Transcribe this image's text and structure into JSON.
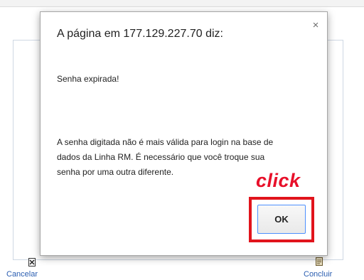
{
  "dialog": {
    "title": "A página em 177.129.227.70 diz:",
    "close_glyph": "×",
    "message_lines": [
      "Senha expirada!",
      "A senha digitada não é mais válida para login na base de",
      "dados da Linha RM. É necessário que você troque sua",
      "senha por uma outra diferente."
    ],
    "ok_label": "OK"
  },
  "annotation": {
    "label": "click",
    "color": "#e1141c"
  },
  "background": {
    "cancel_label": "Cancelar",
    "finish_label": "Concluir",
    "cancel_icon": "document-x-icon",
    "finish_icon": "document-icon"
  }
}
